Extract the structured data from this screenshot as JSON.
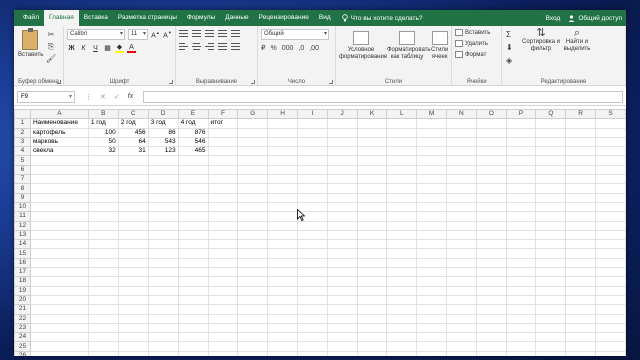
{
  "tabs": [
    {
      "label": "Файл"
    },
    {
      "label": "Главная"
    },
    {
      "label": "Вставка"
    },
    {
      "label": "Разметка страницы"
    },
    {
      "label": "Формулы"
    },
    {
      "label": "Данные"
    },
    {
      "label": "Рецензирование"
    },
    {
      "label": "Вид"
    }
  ],
  "tell_me": "Что вы хотите сделать?",
  "signin": "Вход",
  "share": "Общий доступ",
  "ribbon": {
    "clipboard": {
      "paste": "Вставить",
      "label": "Буфер обмена"
    },
    "font": {
      "name": "Calibri",
      "size": "11",
      "label": "Шрифт"
    },
    "alignment": {
      "label": "Выравнивание"
    },
    "number": {
      "format": "Общий",
      "label": "Число"
    },
    "styles": {
      "conditional": "Условное форматирование",
      "table": "Форматировать как таблицу",
      "cell_styles": "Стили ячеек",
      "label": "Стили"
    },
    "cells": {
      "insert": "Вставить",
      "delete": "Удалить",
      "format": "Формат",
      "label": "Ячейки"
    },
    "editing": {
      "sort": "Сортировка и фильтр",
      "find": "Найти и выделить",
      "label": "Редактирование"
    }
  },
  "name_box": "F9",
  "formula": "",
  "columns": [
    "A",
    "B",
    "C",
    "D",
    "E",
    "F",
    "G",
    "H",
    "I",
    "J",
    "K",
    "L",
    "M",
    "N",
    "O",
    "P",
    "Q",
    "R",
    "S"
  ],
  "sheet_rows": [
    [
      "Наименование",
      "1 год",
      "2 год",
      "3 год",
      "4 год",
      "итог"
    ],
    [
      "картофель",
      "100",
      "456",
      "86",
      "876",
      ""
    ],
    [
      "марковь",
      "50",
      "64",
      "543",
      "546",
      ""
    ],
    [
      "свекла",
      "32",
      "31",
      "123",
      "465",
      ""
    ]
  ],
  "row_count": 26
}
